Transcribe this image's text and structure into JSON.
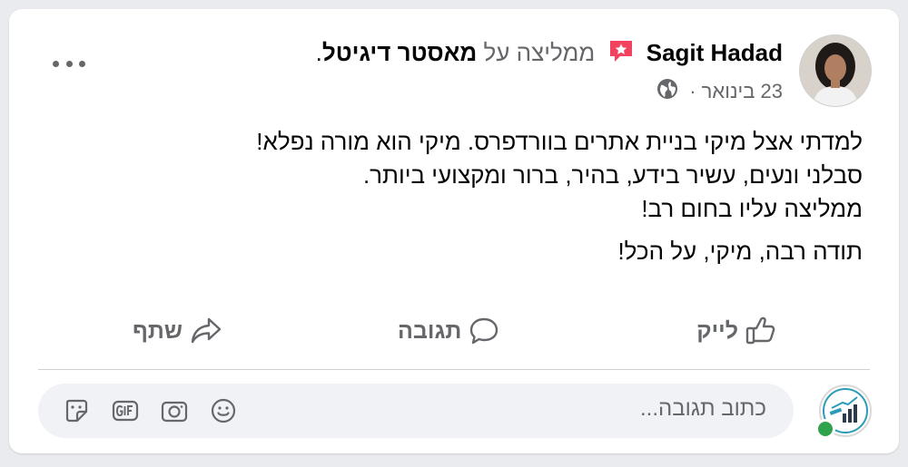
{
  "post": {
    "author": "Sagit Hadad",
    "recommends_text": "ממליצה על",
    "page_name": "מאסטר דיגיטל",
    "period": ".",
    "date": "23 בינואר",
    "separator": "·",
    "lines": [
      "למדתי אצל מיקי בניית אתרים בוורדפרס. מיקי הוא מורה נפלא!",
      "סבלני ונעים, עשיר בידע, בהיר, ברור ומקצועי ביותר.",
      "ממליצה עליו בחום רב!"
    ],
    "closing_line": "תודה רבה, מיקי, על הכל!"
  },
  "actions": {
    "like": "לייק",
    "comment": "תגובה",
    "share": "שתף"
  },
  "comment_input": {
    "placeholder": "כתוב תגובה..."
  },
  "icons": {
    "recommend": "recommend-star-icon",
    "globe": "globe-icon",
    "more": "more-options-icon",
    "like": "thumbs-up-icon",
    "comment": "comment-bubble-icon",
    "share": "share-arrow-icon",
    "emoji": "emoji-icon",
    "camera": "camera-icon",
    "gif": "gif-icon",
    "sticker": "sticker-icon"
  },
  "colors": {
    "accent_pink": "#f3425f",
    "muted": "#65676b",
    "online": "#31a24c"
  }
}
